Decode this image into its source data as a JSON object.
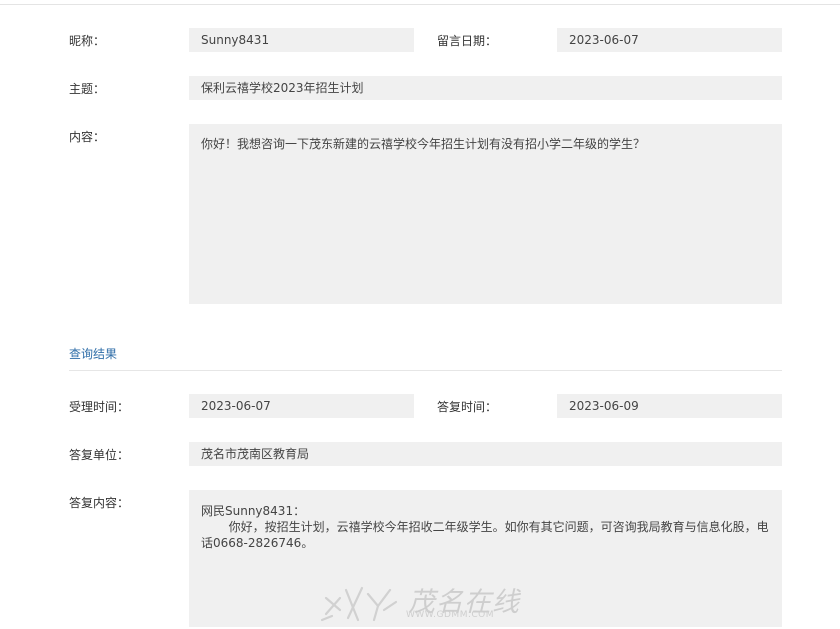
{
  "message": {
    "nickname_label": "昵称：",
    "nickname": "Sunny8431",
    "date_label": "留言日期：",
    "date": "2023-06-07",
    "subject_label": "主题：",
    "subject": "保利云禧学校2023年招生计划",
    "content_label": "内容：",
    "content": "你好！我想咨询一下茂东新建的云禧学校今年招生计划有没有招小学二年级的学生？"
  },
  "result": {
    "section_title": "查询结果",
    "accept_time_label": "受理时间：",
    "accept_time": "2023-06-07",
    "reply_time_label": "答复时间：",
    "reply_time": "2023-06-09",
    "reply_unit_label": "答复单位：",
    "reply_unit": "茂名市茂南区教育局",
    "reply_content_label": "答复内容：",
    "reply_greeting": "网民Sunny8431：",
    "reply_body": "你好，按招生计划，云禧学校今年招收二年级学生。如你有其它问题，可咨询我局教育与信息化股，电话0668-2826746。"
  },
  "watermark": {
    "logo_text": "茂名在线",
    "url": "WWW.GDMM.COM"
  },
  "colors": {
    "field_background": "#f0f0f0",
    "section_title": "#2f6ea8"
  }
}
